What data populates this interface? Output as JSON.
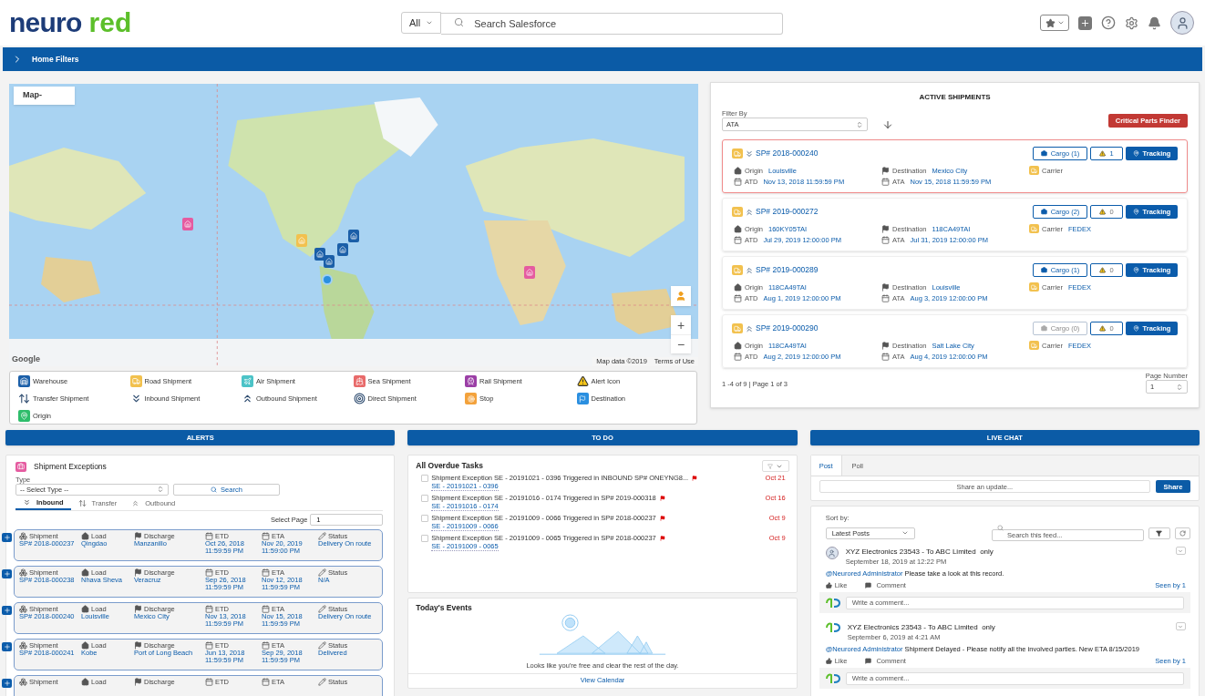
{
  "header": {
    "logo": [
      "neuro",
      "red"
    ],
    "search_scope": "All",
    "search_placeholder": "Search Salesforce"
  },
  "filter_bar": {
    "label": "Home Filters",
    "expanded": false
  },
  "map": {
    "toggle": "Map-",
    "google": "Google",
    "attribution": "Map data ©2019",
    "terms": "Terms of Use",
    "zoom_in": "+",
    "zoom_out": "−"
  },
  "legend": [
    {
      "kind": "warehouse",
      "label": "Warehouse"
    },
    {
      "kind": "road",
      "label": "Road Shipment"
    },
    {
      "kind": "air",
      "label": "Air Shipment"
    },
    {
      "kind": "sea",
      "label": "Sea Shipment"
    },
    {
      "kind": "rail",
      "label": "Rail Shipment"
    },
    {
      "kind": "alert",
      "label": "Alert Icon"
    },
    {
      "kind": "transfer",
      "label": "Transfer Shipment"
    },
    {
      "kind": "inbound",
      "label": "Inbound Shipment"
    },
    {
      "kind": "outbound",
      "label": "Outbound Shipment"
    },
    {
      "kind": "direct",
      "label": "Direct Shipment"
    },
    {
      "kind": "stop",
      "label": "Stop"
    },
    {
      "kind": "destination",
      "label": "Destination"
    },
    {
      "kind": "origin",
      "label": "Origin"
    }
  ],
  "shipments": {
    "title": "ACTIVE SHIPMENTS",
    "filter_label": "Filter By",
    "filter_value": "ATA",
    "critical_button": "Critical Parts Finder",
    "cards": [
      {
        "id": "SP# 2018-000240",
        "kind": "inbound",
        "highlighted": true,
        "cargo": "Cargo (1)",
        "cargo_disabled": false,
        "alerts": "1",
        "alerts_active": true,
        "tracking": "Tracking",
        "fields": [
          {
            "kind": "origin",
            "label": "Origin",
            "value": "Louisville"
          },
          {
            "kind": "destination",
            "label": "Destination",
            "value": "Mexico City"
          },
          {
            "kind": "carrier",
            "label": "Carrier"
          },
          {
            "kind": "atd",
            "label": "ATD",
            "value": "Nov 13, 2018 11:59:59 PM"
          },
          {
            "kind": "ata",
            "label": "ATA",
            "value": "Nov 15, 2018 11:59:59 PM"
          }
        ]
      },
      {
        "id": "SP# 2019-000272",
        "kind": "outbound",
        "highlighted": false,
        "cargo": "Cargo (2)",
        "cargo_disabled": false,
        "alerts": "0",
        "alerts_active": false,
        "tracking": "Tracking",
        "fields": [
          {
            "kind": "origin",
            "label": "Origin",
            "value": "160KY05TAI"
          },
          {
            "kind": "destination",
            "label": "Destination",
            "value": "118CA49TAI"
          },
          {
            "kind": "carrier",
            "label": "Carrier",
            "value": "FEDEX"
          },
          {
            "kind": "atd",
            "label": "ATD",
            "value": "Jul 29, 2019 12:00:00 PM"
          },
          {
            "kind": "ata",
            "label": "ATA",
            "value": "Jul 31, 2019 12:00:00 PM"
          }
        ]
      },
      {
        "id": "SP# 2019-000289",
        "kind": "outbound",
        "highlighted": false,
        "cargo": "Cargo (1)",
        "cargo_disabled": false,
        "alerts": "0",
        "alerts_active": false,
        "tracking": "Tracking",
        "fields": [
          {
            "kind": "origin",
            "label": "Origin",
            "value": "118CA49TAI"
          },
          {
            "kind": "destination",
            "label": "Destination",
            "value": "Louisville"
          },
          {
            "kind": "carrier",
            "label": "Carrier",
            "value": "FEDEX"
          },
          {
            "kind": "atd",
            "label": "ATD",
            "value": "Aug 1, 2019 12:00:00 PM"
          },
          {
            "kind": "ata",
            "label": "ATA",
            "value": "Aug 3, 2019 12:00:00 PM"
          }
        ]
      },
      {
        "id": "SP# 2019-000290",
        "kind": "outbound",
        "highlighted": false,
        "cargo": "Cargo (0)",
        "cargo_disabled": true,
        "alerts": "0",
        "alerts_active": false,
        "tracking": "Tracking",
        "fields": [
          {
            "kind": "origin",
            "label": "Origin",
            "value": "118CA49TAI"
          },
          {
            "kind": "destination",
            "label": "Destination",
            "value": "Salt Lake City"
          },
          {
            "kind": "carrier",
            "label": "Carrier",
            "value": "FEDEX"
          },
          {
            "kind": "atd",
            "label": "ATD",
            "value": "Aug 2, 2019 12:00:00 PM"
          },
          {
            "kind": "ata",
            "label": "ATA",
            "value": "Aug 4, 2019 12:00:00 PM"
          }
        ]
      }
    ],
    "summary": "1 -4 of 9 | Page 1 of 3",
    "page_label": "Page Number",
    "page": "1"
  },
  "alerts": {
    "header": "ALERTS",
    "title": "Shipment Exceptions",
    "type_label": "Type",
    "type_value": "-- Select Type --",
    "search_button": "Search",
    "tabs": [
      {
        "kind": "inbound",
        "label": "Inbound",
        "selected": true
      },
      {
        "kind": "transfer",
        "label": "Transfer",
        "selected": false
      },
      {
        "kind": "outbound",
        "label": "Outbound",
        "selected": false
      }
    ],
    "page_label": "Select Page",
    "page": "1",
    "rows": [
      [
        {
          "kind": "shipment",
          "label": "Shipment",
          "value": "SP# 2018-000237"
        },
        {
          "kind": "load",
          "label": "Load",
          "value": "Qingdao"
        },
        {
          "kind": "discharge",
          "label": "Discharge",
          "value": "Manzanillo"
        },
        {
          "kind": "etd",
          "label": "ETD",
          "value": "Oct 26, 2018\n11:59:59 PM"
        },
        {
          "kind": "eta",
          "label": "ETA",
          "value": "Nov 20, 2019\n11:59:00 PM"
        },
        {
          "kind": "status",
          "label": "Status",
          "value": "Delivery On route"
        }
      ],
      [
        {
          "kind": "shipment",
          "label": "Shipment",
          "value": "SP# 2018-000238"
        },
        {
          "kind": "load",
          "label": "Load",
          "value": "Nhava Sheva"
        },
        {
          "kind": "discharge",
          "label": "Discharge",
          "value": "Veracruz"
        },
        {
          "kind": "etd",
          "label": "ETD",
          "value": "Sep 26, 2018\n11:59:59 PM"
        },
        {
          "kind": "eta",
          "label": "ETA",
          "value": "Nov 12, 2018\n11:59:59 PM"
        },
        {
          "kind": "status",
          "label": "Status",
          "value": "N/A"
        }
      ],
      [
        {
          "kind": "shipment",
          "label": "Shipment",
          "value": "SP# 2018-000240"
        },
        {
          "kind": "load",
          "label": "Load",
          "value": "Louisville"
        },
        {
          "kind": "discharge",
          "label": "Discharge",
          "value": "Mexico City"
        },
        {
          "kind": "etd",
          "label": "ETD",
          "value": "Nov 13, 2018\n11:59:59 PM"
        },
        {
          "kind": "eta",
          "label": "ETA",
          "value": "Nov 15, 2018\n11:59:59 PM"
        },
        {
          "kind": "status",
          "label": "Status",
          "value": "Delivery On route"
        }
      ],
      [
        {
          "kind": "shipment",
          "label": "Shipment",
          "value": "SP# 2018-000241"
        },
        {
          "kind": "load",
          "label": "Load",
          "value": "Kobe"
        },
        {
          "kind": "discharge",
          "label": "Discharge",
          "value": "Port of Long Beach"
        },
        {
          "kind": "etd",
          "label": "ETD",
          "value": "Jun 13, 2018\n11:59:59 PM"
        },
        {
          "kind": "eta",
          "label": "ETA",
          "value": "Sep 29, 2018\n11:59:59 PM"
        },
        {
          "kind": "status",
          "label": "Status",
          "value": "Delivered"
        }
      ],
      [
        {
          "kind": "shipment",
          "label": "Shipment"
        },
        {
          "kind": "load",
          "label": "Load"
        },
        {
          "kind": "discharge",
          "label": "Discharge"
        },
        {
          "kind": "etd",
          "label": "ETD"
        },
        {
          "kind": "eta",
          "label": "ETA"
        },
        {
          "kind": "status",
          "label": "Status"
        }
      ]
    ]
  },
  "todo": {
    "header": "TO DO",
    "title": "All Overdue Tasks",
    "tasks": [
      {
        "text": "Shipment Exception SE - 20191021 - 0396 Triggered in INBOUND SP# ONEYNG8...",
        "link": "SE - 20191021 - 0396",
        "date": "Oct 21",
        "checked": false
      },
      {
        "text": "Shipment Exception SE - 20191016 - 0174 Triggered in SP# 2019-000318",
        "link": "SE - 20191016 - 0174",
        "date": "Oct 16",
        "checked": false
      },
      {
        "text": "Shipment Exception SE - 20191009 - 0066 Triggered in SP# 2018-000237",
        "link": "SE - 20191009 - 0066",
        "date": "Oct 9",
        "checked": false
      },
      {
        "text": "Shipment Exception SE - 20191009 - 0065 Triggered in SP# 2018-000237",
        "link": "SE - 20191009 - 0065",
        "date": "Oct 9",
        "checked": false
      }
    ],
    "events_title": "Today's Events",
    "events_empty": "Looks like you're free and clear the rest of the day.",
    "calendar_link": "View Calendar"
  },
  "chat": {
    "header": "LIVE CHAT",
    "tabs": [
      {
        "label": "Post",
        "selected": true
      },
      {
        "label": "Poll",
        "selected": false
      }
    ],
    "share_placeholder": "Share an update...",
    "share_button": "Share",
    "sort_label": "Sort by:",
    "sort_value": "Latest Posts",
    "search_placeholder": "Search this feed...",
    "posts": [
      {
        "kind": "robot",
        "author": "XYZ Electronics 23543 - To ABC Limited  only",
        "time": "September 18, 2019 at 12:22 PM",
        "mention": "@Neurored Administrator",
        "text": "Please take a look at this record.",
        "like": "Like",
        "comment": "Comment",
        "seen": "Seen by 1",
        "reply_placeholder": "Write a comment..."
      },
      {
        "kind": "logo",
        "author": "XYZ Electronics 23543 - To ABC Limited  only",
        "time": "September 6, 2019 at 4:21 AM",
        "mention": "@Neurored Administrator",
        "text": "Shipment Delayed - Please notify all the involved parties. New ETA 8/15/2019",
        "like": "Like",
        "comment": "Comment",
        "seen": "Seen by 1",
        "reply_placeholder": "Write a comment..."
      }
    ]
  }
}
